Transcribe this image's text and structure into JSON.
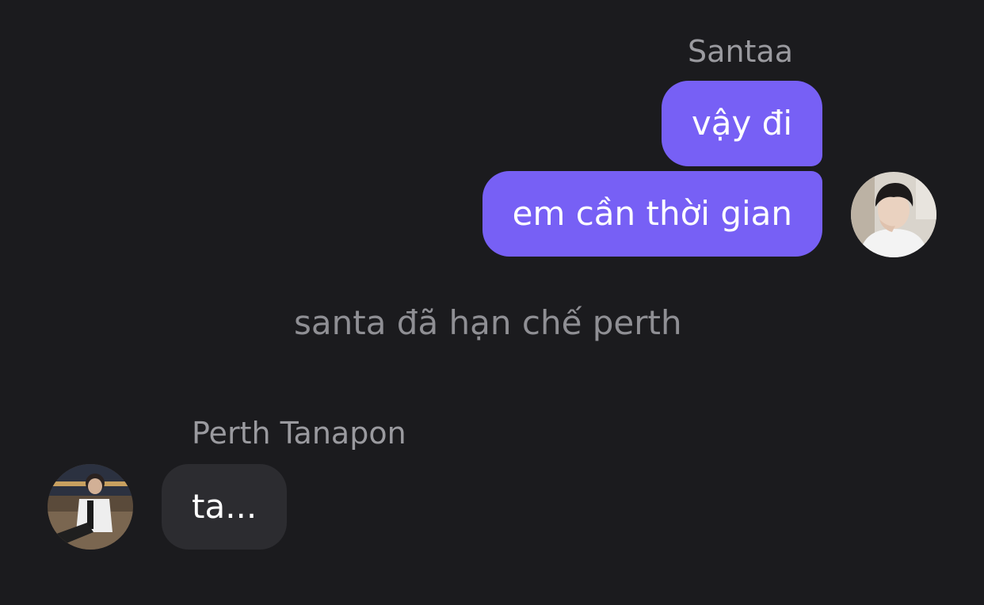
{
  "thread": {
    "outgoing": {
      "sender_name": "Santaa",
      "messages": [
        {
          "text": "vậy đi"
        },
        {
          "text": "em cần thời gian"
        }
      ],
      "avatar_icon": "santa-avatar-photo"
    },
    "system_notice": "santa đã hạn chế perth",
    "incoming": {
      "sender_name": "Perth Tanapon",
      "messages": [
        {
          "text": "ta..."
        }
      ],
      "avatar_icon": "perth-avatar-photo"
    }
  },
  "colors": {
    "background": "#1b1b1e",
    "outgoing_bubble": "#7760f5",
    "incoming_bubble": "#2c2c30",
    "name_text": "#9a9a9f",
    "system_text": "#8f8f94"
  }
}
